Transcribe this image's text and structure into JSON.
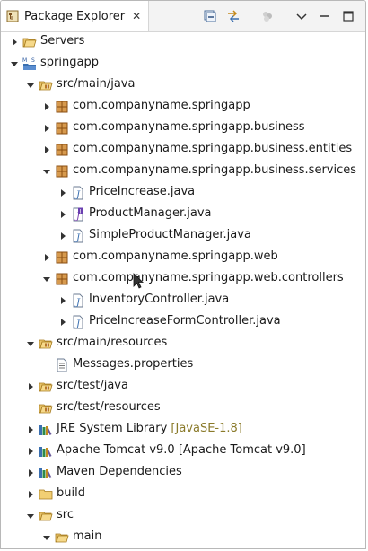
{
  "view": {
    "title": "Package Explorer",
    "close_glyph": "✕",
    "toolbar": [
      "collapse-all-icon",
      "link-with-editor-icon",
      "filters-icon",
      "view-menu-icon",
      "minimize-icon",
      "maximize-icon"
    ]
  },
  "tree": [
    {
      "label": "Servers",
      "icon": "folder-open-icon",
      "twisty": "collapsed",
      "level": 0
    },
    {
      "label": "springapp",
      "icon": "maven-project-icon",
      "twisty": "expanded",
      "level": 0
    },
    {
      "label": "src/main/java",
      "icon": "source-folder-icon",
      "twisty": "expanded",
      "level": 1
    },
    {
      "label": "com.companyname.springapp",
      "icon": "package-icon",
      "twisty": "collapsed",
      "level": 2
    },
    {
      "label": "com.companyname.springapp.business",
      "icon": "package-icon",
      "twisty": "collapsed",
      "level": 2
    },
    {
      "label": "com.companyname.springapp.business.entities",
      "icon": "package-icon",
      "twisty": "collapsed",
      "level": 2
    },
    {
      "label": "com.companyname.springapp.business.services",
      "icon": "package-icon",
      "twisty": "expanded",
      "level": 2
    },
    {
      "label": "PriceIncrease.java",
      "icon": "java-file-icon",
      "twisty": "collapsed",
      "level": 3
    },
    {
      "label": "ProductManager.java",
      "icon": "java-interface-file-icon",
      "twisty": "collapsed",
      "level": 3
    },
    {
      "label": "SimpleProductManager.java",
      "icon": "java-file-icon",
      "twisty": "collapsed",
      "level": 3
    },
    {
      "label": "com.companyname.springapp.web",
      "icon": "package-icon",
      "twisty": "collapsed",
      "level": 2
    },
    {
      "label": "com.companyname.springapp.web.controllers",
      "icon": "package-icon",
      "twisty": "expanded",
      "level": 2
    },
    {
      "label": "InventoryController.java",
      "icon": "java-file-icon",
      "twisty": "collapsed",
      "level": 3
    },
    {
      "label": "PriceIncreaseFormController.java",
      "icon": "java-file-icon",
      "twisty": "collapsed",
      "level": 3
    },
    {
      "label": "src/main/resources",
      "icon": "source-folder-icon",
      "twisty": "expanded",
      "level": 1
    },
    {
      "label": "Messages.properties",
      "icon": "properties-file-icon",
      "twisty": "none",
      "level": 2
    },
    {
      "label": "src/test/java",
      "icon": "source-folder-icon",
      "twisty": "collapsed",
      "level": 1
    },
    {
      "label": "src/test/resources",
      "icon": "source-folder-icon",
      "twisty": "none",
      "level": 1
    },
    {
      "label": "JRE System Library",
      "decoration": "[JavaSE-1.8]",
      "icon": "library-icon",
      "twisty": "collapsed",
      "level": 1
    },
    {
      "label": "Apache Tomcat v9.0 [Apache Tomcat v9.0]",
      "icon": "library-icon",
      "twisty": "collapsed",
      "level": 1
    },
    {
      "label": "Maven Dependencies",
      "icon": "library-icon",
      "twisty": "collapsed",
      "level": 1
    },
    {
      "label": "build",
      "icon": "folder-icon",
      "twisty": "collapsed",
      "level": 1
    },
    {
      "label": "src",
      "icon": "folder-open-icon",
      "twisty": "expanded",
      "level": 1
    },
    {
      "label": "main",
      "icon": "folder-open-icon",
      "twisty": "expanded",
      "level": 2
    }
  ],
  "colors": {
    "tab_bg": "#f3f3f3",
    "folder": "#d9a441",
    "package": "#b5762b",
    "java_blue": "#3a6fb0",
    "decoration": "#8a7a2a"
  }
}
